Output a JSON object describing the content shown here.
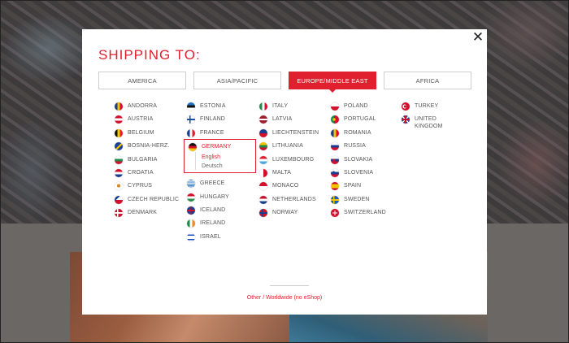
{
  "modal": {
    "title": "SHIPPING TO:",
    "close_label": "✕",
    "other_link": "Other / Worldwide (no eShop)"
  },
  "tabs": [
    {
      "label": "AMERICA",
      "active": false
    },
    {
      "label": "ASIA/PACIFIC",
      "active": false
    },
    {
      "label": "EUROPE/MIDDLE EAST",
      "active": true
    },
    {
      "label": "AFRICA",
      "active": false
    }
  ],
  "columns": [
    [
      {
        "name": "ANDORRA",
        "flag": "andorra-flag-icon"
      },
      {
        "name": "AUSTRIA",
        "flag": "austria-flag-icon"
      },
      {
        "name": "BELGIUM",
        "flag": "belgium-flag-icon"
      },
      {
        "name": "BOSNIA-HERZ.",
        "flag": "bosnia-flag-icon"
      },
      {
        "name": "BULGARIA",
        "flag": "bulgaria-flag-icon"
      },
      {
        "name": "CROATIA",
        "flag": "croatia-flag-icon"
      },
      {
        "name": "CYPRUS",
        "flag": "cyprus-flag-icon"
      },
      {
        "name": "CZECH REPUBLIC",
        "flag": "czech-flag-icon"
      },
      {
        "name": "DENMARK",
        "flag": "denmark-flag-icon"
      }
    ],
    [
      {
        "name": "ESTONIA",
        "flag": "estonia-flag-icon"
      },
      {
        "name": "FINLAND",
        "flag": "finland-flag-icon"
      },
      {
        "name": "FRANCE",
        "flag": "france-flag-icon"
      },
      {
        "name": "GERMANY",
        "flag": "germany-flag-icon",
        "expanded": true,
        "languages": [
          "English",
          "Deutsch"
        ]
      },
      {
        "name": "GREECE",
        "flag": "greece-flag-icon"
      },
      {
        "name": "HUNGARY",
        "flag": "hungary-flag-icon"
      },
      {
        "name": "ICELAND",
        "flag": "iceland-flag-icon"
      },
      {
        "name": "IRELAND",
        "flag": "ireland-flag-icon"
      },
      {
        "name": "ISRAEL",
        "flag": "israel-flag-icon"
      }
    ],
    [
      {
        "name": "ITALY",
        "flag": "italy-flag-icon"
      },
      {
        "name": "LATVIA",
        "flag": "latvia-flag-icon"
      },
      {
        "name": "LIECHTENSTEIN",
        "flag": "liechtenstein-flag-icon"
      },
      {
        "name": "LITHUANIA",
        "flag": "lithuania-flag-icon"
      },
      {
        "name": "LUXEMBOURG",
        "flag": "luxembourg-flag-icon"
      },
      {
        "name": "MALTA",
        "flag": "malta-flag-icon"
      },
      {
        "name": "MONACO",
        "flag": "monaco-flag-icon"
      },
      {
        "name": "NETHERLANDS",
        "flag": "netherlands-flag-icon"
      },
      {
        "name": "NORWAY",
        "flag": "norway-flag-icon"
      }
    ],
    [
      {
        "name": "POLAND",
        "flag": "poland-flag-icon"
      },
      {
        "name": "PORTUGAL",
        "flag": "portugal-flag-icon"
      },
      {
        "name": "ROMANIA",
        "flag": "romania-flag-icon"
      },
      {
        "name": "RUSSIA",
        "flag": "russia-flag-icon"
      },
      {
        "name": "SLOVAKIA",
        "flag": "slovakia-flag-icon"
      },
      {
        "name": "SLOVENIA",
        "flag": "slovenia-flag-icon"
      },
      {
        "name": "SPAIN",
        "flag": "spain-flag-icon"
      },
      {
        "name": "SWEDEN",
        "flag": "sweden-flag-icon"
      },
      {
        "name": "SWITZERLAND",
        "flag": "switzerland-flag-icon"
      }
    ],
    [
      {
        "name": "TURKEY",
        "flag": "turkey-flag-icon"
      },
      {
        "name": "UNITED KINGDOM",
        "flag": "uk-flag-icon"
      }
    ]
  ],
  "colors": {
    "accent": "#e0202e"
  }
}
